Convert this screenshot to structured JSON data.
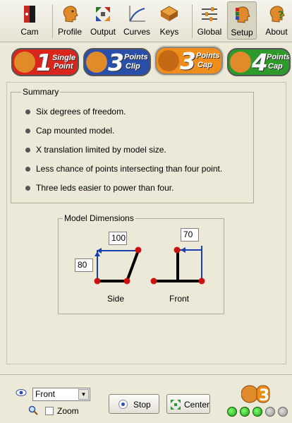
{
  "toolbar": {
    "items": [
      {
        "label": "Cam",
        "icon": "camera-icon"
      },
      {
        "label": "Profile",
        "icon": "profile-head-icon"
      },
      {
        "label": "Output",
        "icon": "output-arrows-icon"
      },
      {
        "label": "Curves",
        "icon": "curves-icon"
      },
      {
        "label": "Keys",
        "icon": "keys-icon"
      },
      {
        "label": "Global",
        "icon": "sliders-icon"
      },
      {
        "label": "Setup",
        "icon": "setup-head-icon",
        "active": true
      },
      {
        "label": "About",
        "icon": "about-question-icon"
      }
    ]
  },
  "mode_tabs": [
    {
      "number": "1",
      "line1": "Single",
      "line2": "Point",
      "color": "#d8261d"
    },
    {
      "number": "3",
      "line1": "Points",
      "line2": "Clip",
      "color": "#2a4fa8"
    },
    {
      "number": "3",
      "line1": "Points",
      "line2": "Cap",
      "color": "#f08c1a",
      "active": true
    },
    {
      "number": "4",
      "line1": "Points",
      "line2": "Cap",
      "color": "#2e9a2c"
    }
  ],
  "summary": {
    "title": "Summary",
    "items": [
      "Six degrees of freedom.",
      "Cap mounted model.",
      "X translation limited by model size.",
      "Less chance of points intersecting than four point.",
      "Three leds easier to power than four."
    ]
  },
  "model_dimensions": {
    "title": "Model Dimensions",
    "side_width": "100",
    "side_height": "80",
    "front_width": "70",
    "side_label": "Side",
    "front_label": "Front"
  },
  "footer": {
    "view_select": "Front",
    "zoom_label": "Zoom",
    "stop_label": "Stop",
    "center_label": "Center",
    "zoom_checked": false,
    "led_states": [
      "green",
      "green",
      "green",
      "grey",
      "grey"
    ]
  }
}
